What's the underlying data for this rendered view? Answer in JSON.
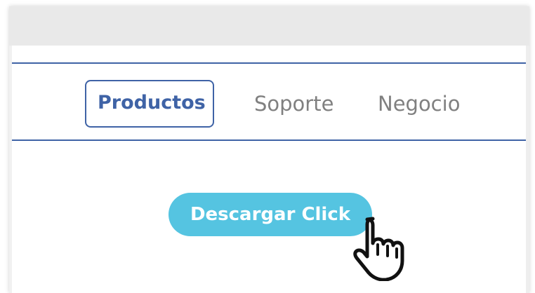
{
  "nav": {
    "tabs": [
      {
        "label": "Productos",
        "active": true
      },
      {
        "label": "Soporte",
        "active": false
      },
      {
        "label": "Negocio",
        "active": false
      }
    ]
  },
  "main": {
    "download_button_label": "Descargar Click"
  },
  "colors": {
    "accent": "#3f63a6",
    "button": "#55c4e1",
    "inactive_text": "#808080",
    "titlebar": "#e9e9e9"
  },
  "icons": {
    "cursor": "hand-pointer-icon"
  }
}
